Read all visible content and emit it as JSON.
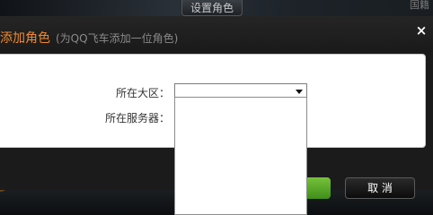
{
  "background": {
    "tab_label": "设置角色",
    "corner_text": "国籍"
  },
  "dialog": {
    "title": "添加角色",
    "subtitle": "(为QQ飞车添加一位角色)",
    "close_symbol": "×",
    "fields": [
      {
        "label": "所在大区：",
        "value": ""
      },
      {
        "label": "所在服务器：",
        "value": ""
      }
    ],
    "cancel_label": "取 消",
    "colors": {
      "title_accent": "#f08a30",
      "confirm_green": "#5aa827"
    }
  }
}
